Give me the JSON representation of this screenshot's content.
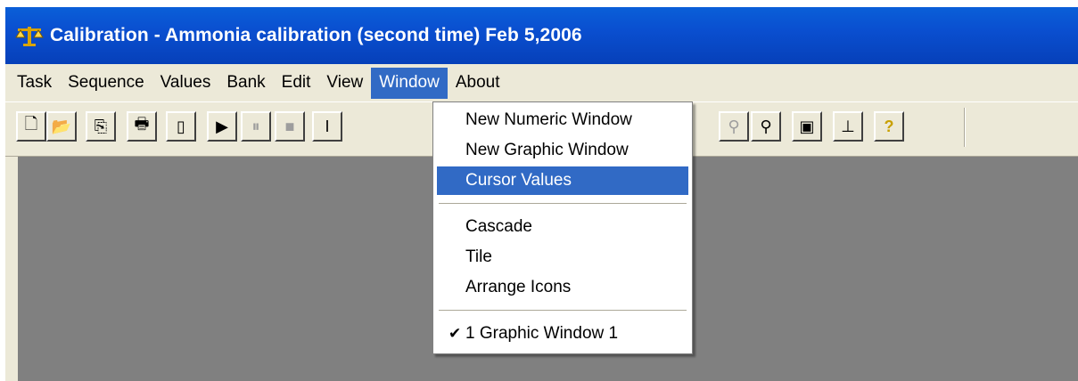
{
  "title": {
    "text": "Calibration - Ammonia calibration (second time) Feb 5,2006",
    "icon": "balance-scale-icon"
  },
  "menubar": {
    "items": [
      "Task",
      "Sequence",
      "Values",
      "Bank",
      "Edit",
      "View",
      "Window",
      "About"
    ],
    "active": "Window"
  },
  "toolbar": {
    "buttons": [
      {
        "name": "new-file-icon",
        "glyph": "🗋"
      },
      {
        "name": "open-folder-icon",
        "glyph": "📂"
      },
      {
        "name": "copy-icon",
        "glyph": "⎘"
      },
      {
        "name": "print-icon",
        "glyph": "🖶"
      },
      {
        "name": "document-icon",
        "glyph": "▯"
      },
      {
        "name": "play-icon",
        "glyph": "▶"
      },
      {
        "name": "pause-icon",
        "glyph": "⏸"
      },
      {
        "name": "stop-icon",
        "glyph": "■"
      },
      {
        "name": "text-icon",
        "glyph": "I"
      },
      {
        "name": "zoom-out-icon",
        "glyph": "⚲"
      },
      {
        "name": "zoom-in-icon",
        "glyph": "⚲"
      },
      {
        "name": "properties-icon",
        "glyph": "▣"
      },
      {
        "name": "graph-icon",
        "glyph": "⊥"
      },
      {
        "name": "help-icon",
        "glyph": "?"
      }
    ]
  },
  "window_menu": {
    "items": [
      {
        "label": "New Numeric Window"
      },
      {
        "label": "New Graphic Window"
      },
      {
        "label": "Cursor Values",
        "highlighted": true
      },
      {
        "label": "Cascade"
      },
      {
        "label": "Tile"
      },
      {
        "label": "Arrange Icons"
      },
      {
        "label": "1 Graphic Window 1",
        "checked": true
      }
    ],
    "check_glyph": "✔"
  },
  "colors": {
    "titlebar": "#0a4fd0",
    "highlight": "#316ac5",
    "mdi_background": "#808080",
    "chrome": "#ece9d8"
  }
}
